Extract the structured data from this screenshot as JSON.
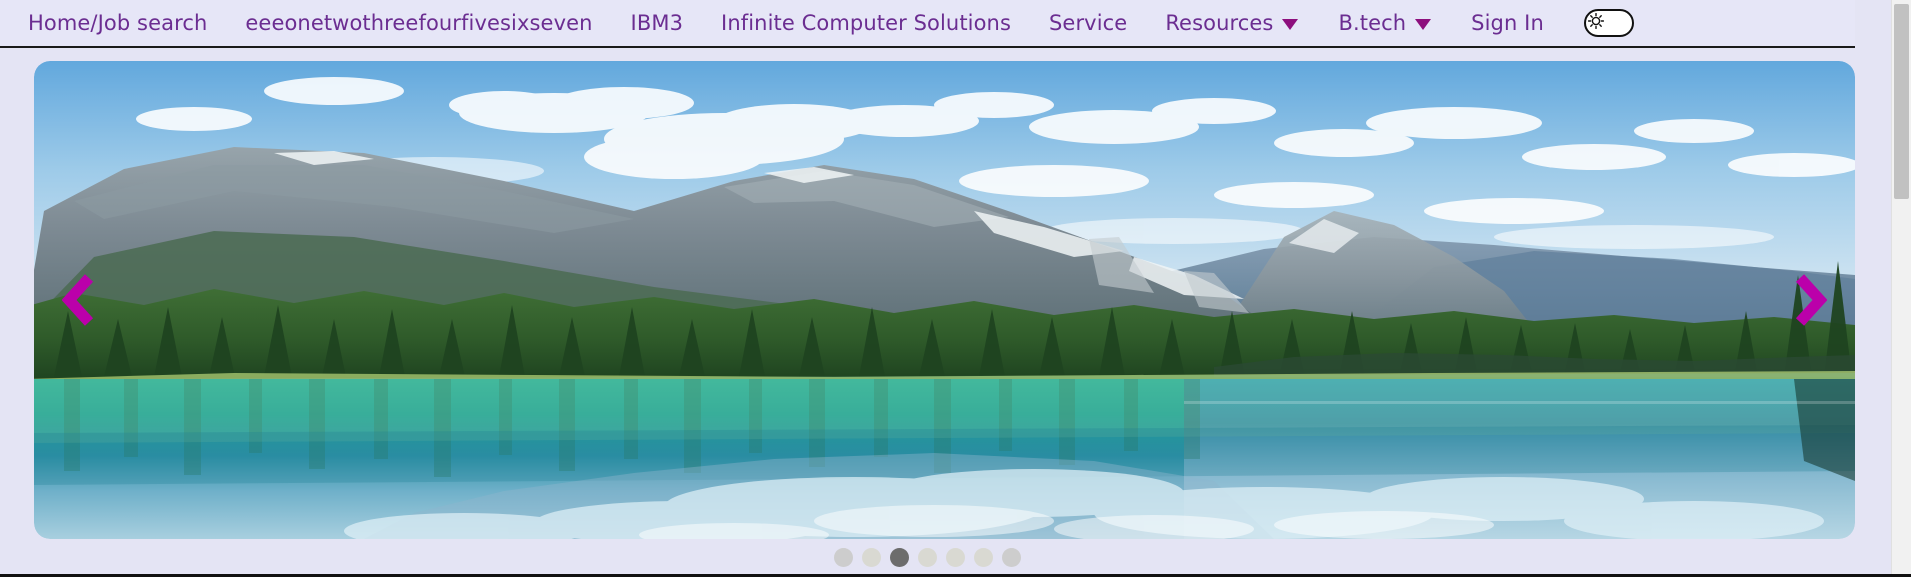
{
  "theme": {
    "page_background": "#e4e4f4",
    "navbar_background": "#e6e6f7",
    "nav_link_color": "#6b2d91",
    "caret_color": "#8d0f7d",
    "arrow_color": "#bb00aa",
    "dot_inactive_color": "#cdcdcd",
    "dot_active_color": "#6c6c6c"
  },
  "navbar": {
    "items": [
      {
        "label": "Home/Job search",
        "has_dropdown": false
      },
      {
        "label": "eeeonetwothreefourfivesixseven",
        "has_dropdown": false
      },
      {
        "label": "IBM3",
        "has_dropdown": false
      },
      {
        "label": "Infinite Computer Solutions",
        "has_dropdown": false
      },
      {
        "label": "Service",
        "has_dropdown": false
      },
      {
        "label": "Resources",
        "has_dropdown": true
      },
      {
        "label": "B.tech",
        "has_dropdown": true
      },
      {
        "label": "Sign In",
        "has_dropdown": false
      }
    ],
    "theme_toggle": {
      "icon": "sun-icon",
      "state": "off",
      "aria_label": "Toggle dark mode"
    }
  },
  "carousel": {
    "prev_icon": "chevron-left-icon",
    "next_icon": "chevron-right-icon",
    "slide_alt": "Mountain lake with forest reflection",
    "total_slides": 7,
    "active_slide": 3,
    "dots": [
      {
        "index": 1,
        "active": false
      },
      {
        "index": 2,
        "active": false
      },
      {
        "index": 3,
        "active": true
      },
      {
        "index": 4,
        "active": false
      },
      {
        "index": 5,
        "active": false
      },
      {
        "index": 6,
        "active": false
      },
      {
        "index": 7,
        "active": false
      }
    ]
  },
  "scrollbar": {
    "orientation": "vertical",
    "position": "top"
  }
}
